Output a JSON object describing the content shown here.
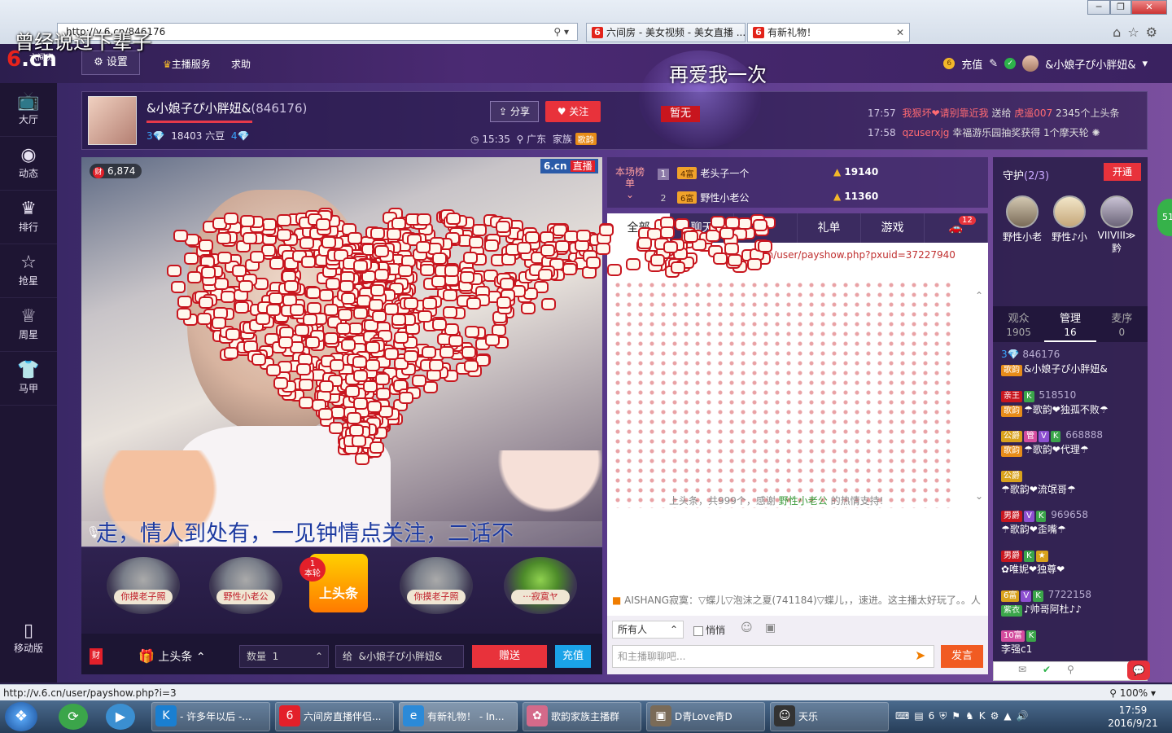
{
  "browser": {
    "address": "http://v.6.cn/846176",
    "tabs": [
      {
        "label": "六间房 - 美女视频 - 美女直播 ..."
      },
      {
        "label": "有新礼物！"
      }
    ],
    "lyric_overlay": "曾经说过下辈子"
  },
  "header": {
    "logo_six": "6",
    "logo_cn": ".cn",
    "logo_sub": "六间房",
    "settings_label": "设置",
    "anchor_service": "主播服务",
    "help": "求助",
    "banner_text": "再爱我一次",
    "zanwu": "暂无",
    "recharge": "充值",
    "username": "&小娘子ぴ小胖妞&"
  },
  "left_nav": {
    "items": [
      {
        "label": "大厅",
        "icon": "tv-icon"
      },
      {
        "label": "动态",
        "icon": "compass-icon"
      },
      {
        "label": "排行",
        "icon": "crown-icon"
      },
      {
        "label": "抢星",
        "icon": "star-icon"
      },
      {
        "label": "周星",
        "icon": "trophy-icon"
      },
      {
        "label": "马甲",
        "icon": "vest-icon"
      }
    ],
    "mobile": "移动版"
  },
  "anchor": {
    "name": "&小娘子ぴ小胖妞&",
    "room_id": "(846176)",
    "level_left": "3",
    "beans": "18403 六豆",
    "level_right": "4",
    "share": "分享",
    "follow": "关注",
    "time": "15:35",
    "location": "广东",
    "family_label": "家族",
    "family_badge": "歌韵"
  },
  "notices": [
    {
      "time": "17:57",
      "text_red": "我狠坏❤请别靠近我",
      "text": " 送给 ",
      "text_red2": "虎遥007",
      "text2": " 2345个上头条"
    },
    {
      "time": "17:58",
      "text_red": "qzuserxjg",
      "text": " 幸福游乐园抽奖获得 1个摩天轮",
      "text_red2": "",
      "text2": ""
    }
  ],
  "video": {
    "fortune": "6,874",
    "live_logo": "6.cn",
    "live_tag": "直播",
    "subtitle": "走，情人到处有，一见钟情点关注，二话不"
  },
  "rank": {
    "title": "本场榜单",
    "rows": [
      {
        "n": "1",
        "level": "4富",
        "name": "老头子一个",
        "score": "19140"
      },
      {
        "n": "2",
        "level": "6富",
        "name": "野性小老公",
        "score": "11360"
      }
    ]
  },
  "chat": {
    "tabs": [
      "全部",
      "聊天",
      "",
      "礼单",
      "游戏"
    ],
    "cart_badge": "12",
    "link": "cn/user/payshow.php?pxuid=37227940",
    "thanks_prefix": "上头条，共999个，感谢 ",
    "thanks_name": "野性小老公",
    "thanks_suffix": " 的热情支持!",
    "line": "AISHANG寂寞：▽蝶儿▽泡沫之夏(741184)▽蝶儿，，速进。这主播太好玩了。。人",
    "to_select": "所有人",
    "quiet": "悄悄",
    "input_placeholder": "和主播聊聊吧...",
    "send": "发言"
  },
  "gifts": {
    "slots": [
      "你摸老子照",
      "野性小老公",
      "你摸老子照",
      "···寂寞ヤ"
    ],
    "hot_label": "上头条",
    "hot_badge_num": "1",
    "hot_badge_text": "本轮",
    "headline": "上头条",
    "qty_label": "数量",
    "qty_value": "1",
    "to_label": "给",
    "to_name": "&小娘子ぴ小胖妞&",
    "give": "赠送",
    "recharge": "充值",
    "wealth": "财"
  },
  "right_panel": {
    "guard_title": "守护",
    "guard_count": "(2/3)",
    "open": "开通",
    "guards": [
      "野性小老",
      "野性♪小",
      "VIIVIII≫黔"
    ],
    "aud_tabs": [
      {
        "label": "观众",
        "num": "1905"
      },
      {
        "label": "管理",
        "num": "16"
      },
      {
        "label": "麦序",
        "num": "0"
      }
    ],
    "side_circle": "51",
    "audience": [
      {
        "badges": [
          "3💎"
        ],
        "id": "846176",
        "badge2": "歌韵",
        "name": "&小娘子ぴ小胖妞&"
      },
      {
        "badges": [
          "亲王",
          "K"
        ],
        "id": "518510",
        "badge2": "歌韵",
        "name": "☂歌韵❤独孤不败☂"
      },
      {
        "badges": [
          "公爵",
          "管",
          "V",
          "K"
        ],
        "id": "668888",
        "badge2": "歌韵",
        "name": "☂歌韵❤代理☂"
      },
      {
        "badges": [
          "公爵"
        ],
        "id": "",
        "badge2": "",
        "name": "☂歌韵❤流氓哥☂"
      },
      {
        "badges": [
          "男爵",
          "V",
          "K"
        ],
        "id": "969658",
        "badge2": "",
        "name": "☂歌韵❤歪嘴☂"
      },
      {
        "badges": [
          "男爵",
          "K",
          "★"
        ],
        "id": "",
        "badge2": "",
        "name": "✿唯妮❤独尊❤"
      },
      {
        "badges": [
          "6富",
          "V",
          "K"
        ],
        "id": "7722158",
        "badge2": "紫衣",
        "name": "♪帅哥阿杜♪♪"
      },
      {
        "badges": [
          "10富",
          "K"
        ],
        "id": "",
        "badge2": "",
        "name": "李强c1"
      }
    ]
  },
  "status": {
    "url": "http://v.6.cn/user/payshow.php?i=3",
    "zoom": "100%"
  },
  "taskbar": {
    "items": [
      {
        "label": "- 许多年以后 -...",
        "icon": "k-icon"
      },
      {
        "label": "六间房直播伴侣...",
        "icon": "six-icon"
      },
      {
        "label": "有新礼物！ - In...",
        "icon": "ie-icon"
      },
      {
        "label": "歌韵家族主播群",
        "icon": "flower-icon"
      },
      {
        "label": "D青Love青D",
        "icon": "photo-icon"
      },
      {
        "label": "天乐",
        "icon": "person-icon"
      }
    ],
    "time": "17:59",
    "date": "2016/9/21"
  }
}
